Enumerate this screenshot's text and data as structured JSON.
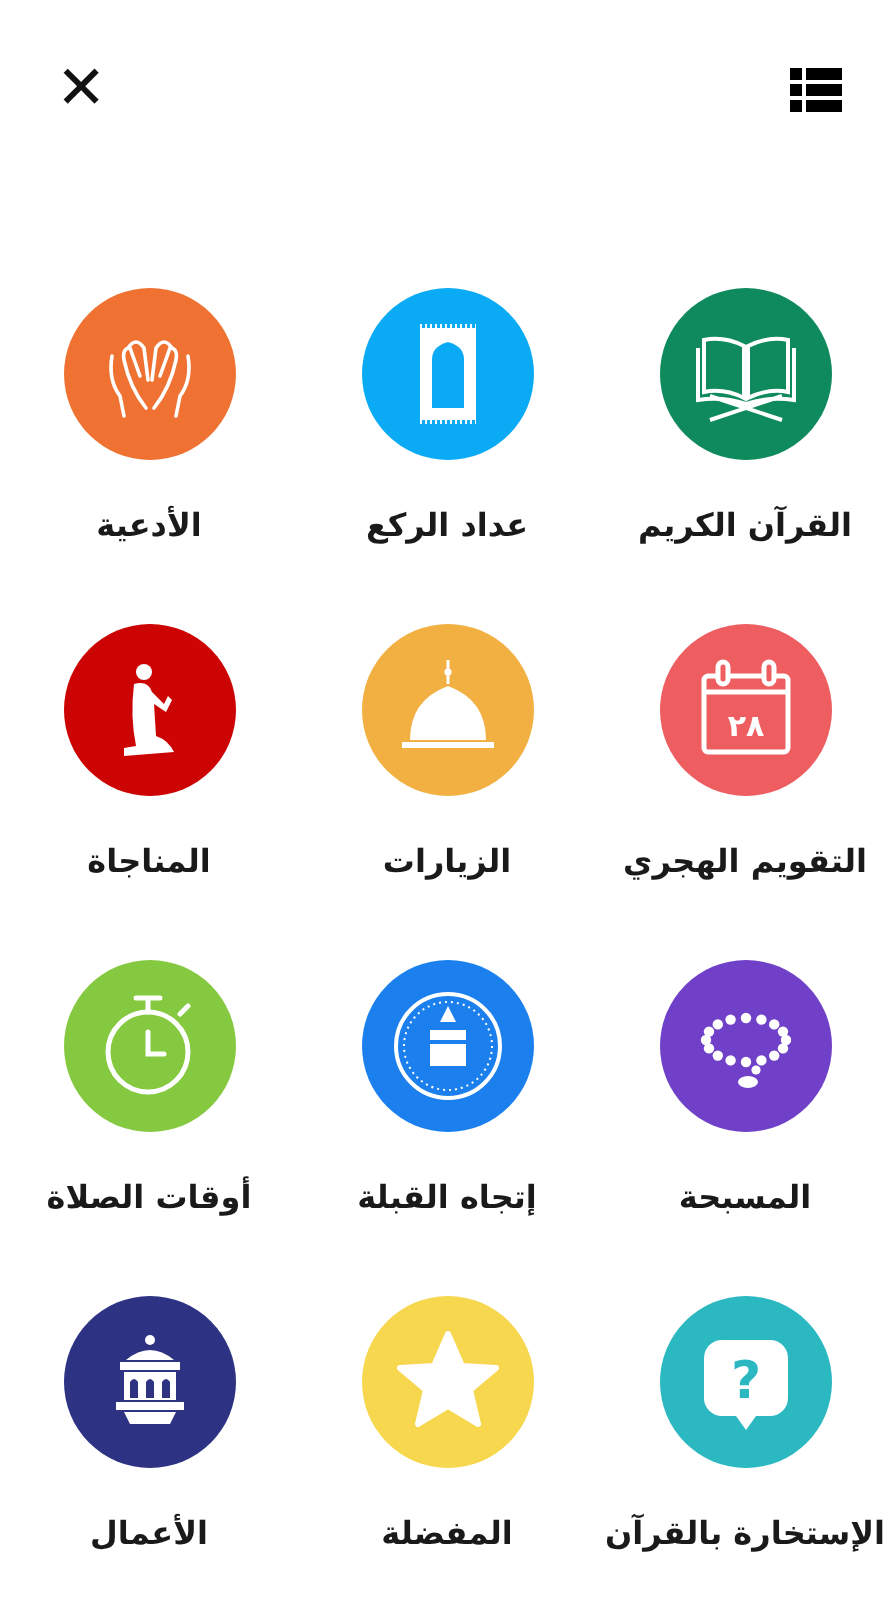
{
  "header": {
    "close": "✕"
  },
  "items": [
    {
      "label": "القرآن الكريم",
      "kind": "quran",
      "color": "#0f8a5c"
    },
    {
      "label": "عداد الركع",
      "kind": "rug",
      "color": "#0aaaf5"
    },
    {
      "label": "الأدعية",
      "kind": "hands",
      "color": "#ef7233"
    },
    {
      "label": "التقويم الهجري",
      "kind": "calendar",
      "color": "#ee5d5f",
      "glyph": "٢٨"
    },
    {
      "label": "الزيارات",
      "kind": "dome",
      "color": "#f1b041"
    },
    {
      "label": "المناجاة",
      "kind": "kneeling",
      "color": "#cc0404"
    },
    {
      "label": "المسبحة",
      "kind": "beads",
      "color": "#7040c8"
    },
    {
      "label": "إتجاه القبلة",
      "kind": "qibla",
      "color": "#1b80ee"
    },
    {
      "label": "أوقات الصلاة",
      "kind": "stopwatch",
      "color": "#84c940"
    },
    {
      "label": "الإستخارة بالقرآن",
      "kind": "question",
      "color": "#2bb8c1",
      "glyph": "?"
    },
    {
      "label": "المفضلة",
      "kind": "star",
      "color": "#f7d74e"
    },
    {
      "label": "الأعمال",
      "kind": "lantern",
      "color": "#2d3282"
    }
  ]
}
